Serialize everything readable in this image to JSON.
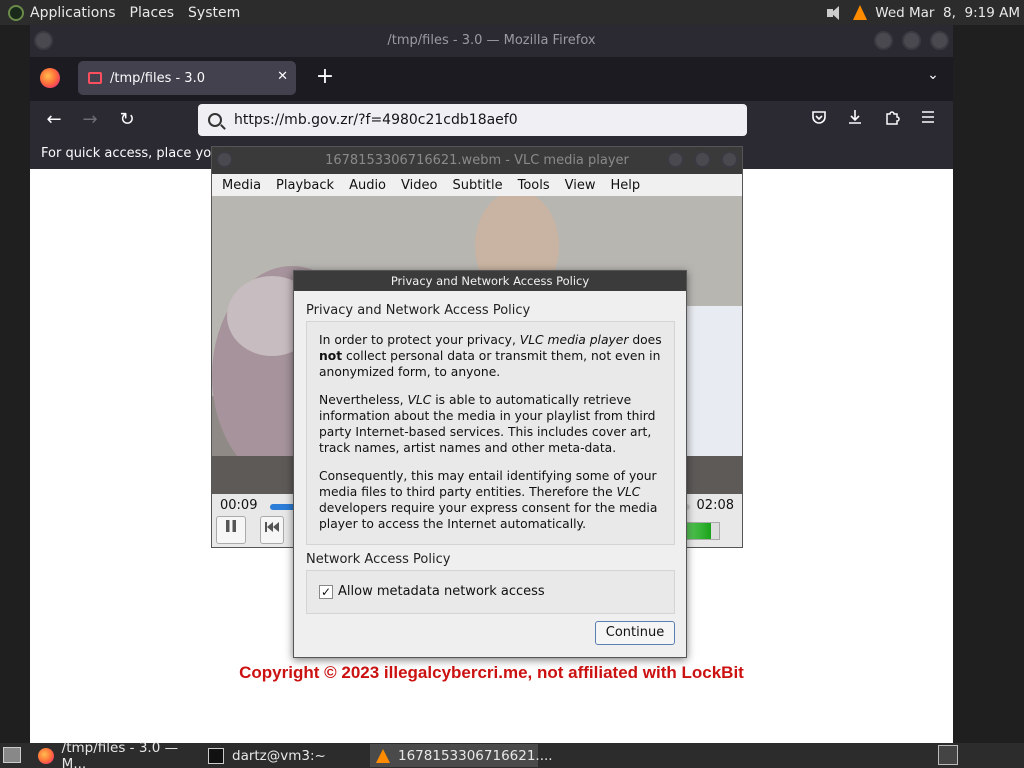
{
  "top_panel": {
    "menus": [
      "Applications",
      "Places",
      "System"
    ],
    "clock": "Wed Mar  8,  9:19 AM",
    "icons": {
      "logo": "gnome-foot-icon",
      "volume": "volume-icon",
      "vlc": "vlc-cone-icon"
    }
  },
  "firefox": {
    "window_title": "/tmp/files - 3.0 — Mozilla Firefox",
    "tab_title": "/tmp/files - 3.0",
    "url": "https://mb.gov.zr/?f=4980c21cdb18aef0",
    "bookmarks_hint": "For quick access, place your b",
    "copyright": "Copyright © 2023 illegalcybercri.me, not affiliated with LockBit",
    "icons": {
      "back": "←",
      "forward": "→",
      "reload": "↻",
      "pocket": "pocket-icon",
      "downloads": "download-icon",
      "extensions": "puzzle-icon",
      "menu": "hamburger-icon"
    }
  },
  "vlc": {
    "window_title": "1678153306716621.webm - VLC media player",
    "menu": [
      "Media",
      "Playback",
      "Audio",
      "Video",
      "Subtitle",
      "Tools",
      "View",
      "Help"
    ],
    "time_elapsed": "00:09",
    "time_total": "02:08",
    "seek_progress": 0.07,
    "volume_level": 0.8
  },
  "dialog": {
    "title": "Privacy and Network Access Policy",
    "heading": "Privacy and Network Access Policy",
    "paragraph1": {
      "a": "In order to protect your privacy, ",
      "b": "VLC media player",
      "c": " does ",
      "d": "not",
      "e": " collect personal data or transmit them, not even in anonymized form, to anyone."
    },
    "paragraph2": {
      "a": "Nevertheless, ",
      "b": "VLC",
      "c": " is able to automatically retrieve information about the media in your playlist from third party Internet-based services. This includes cover art, track names, artist names and other meta-data."
    },
    "paragraph3": {
      "a": "Consequently, this may entail identifying some of your media files to third party entities. Therefore the ",
      "b": "VLC",
      "c": " developers require your express consent for the media player to access the Internet automatically."
    },
    "network_heading": "Network Access Policy",
    "checkbox_label": "Allow metadata network access",
    "checkbox_checked": true,
    "checkbox_mark": "✓",
    "continue_label": "Continue"
  },
  "bottom_panel": {
    "tasks": [
      {
        "label": "/tmp/files - 3.0 — M..."
      },
      {
        "label": "dartz@vm3:~"
      },
      {
        "label": "1678153306716621...."
      }
    ]
  }
}
